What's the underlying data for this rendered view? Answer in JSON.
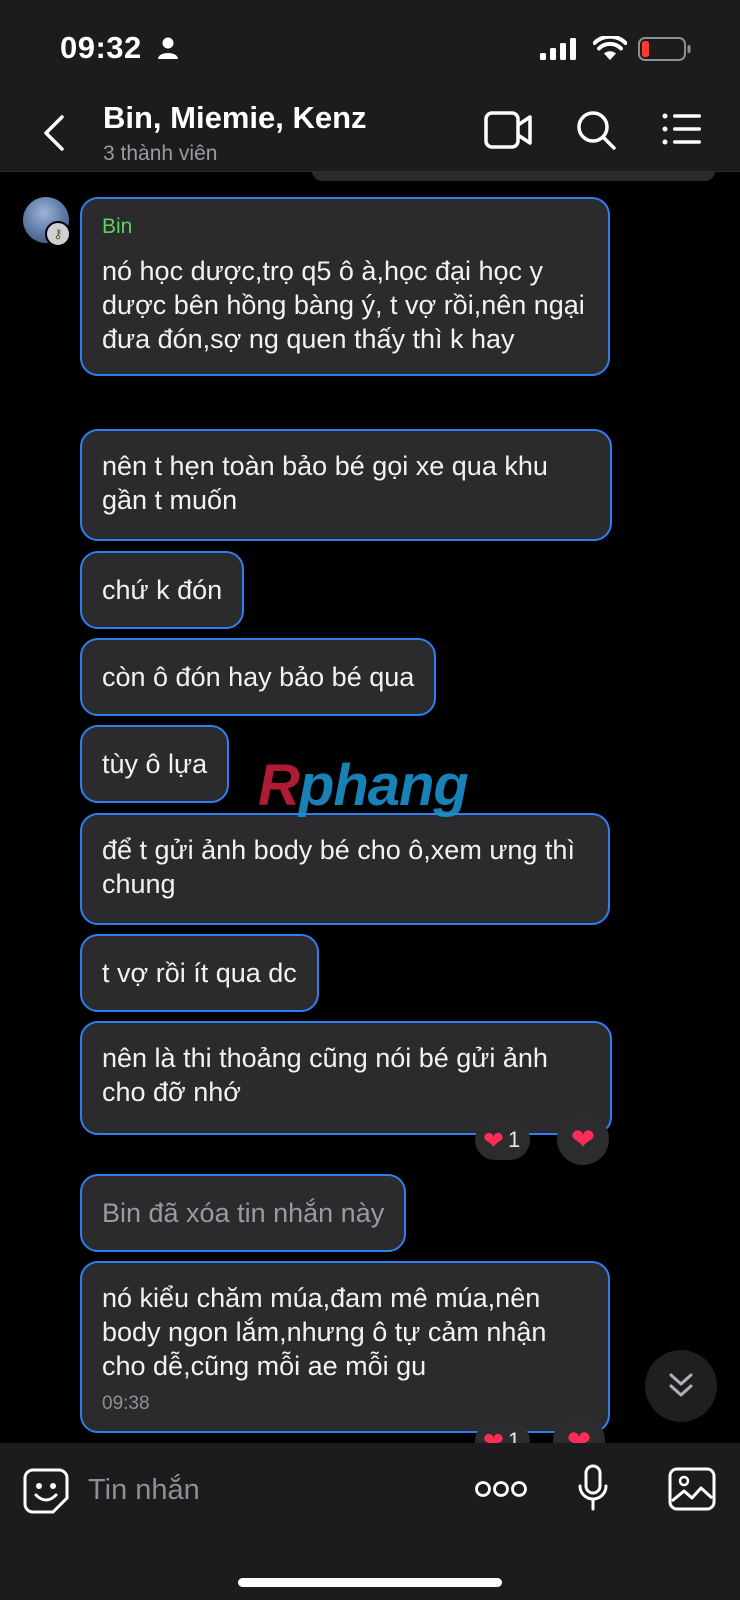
{
  "status_bar": {
    "time": "09:32"
  },
  "header": {
    "title": "Bin, Miemie, Kenz",
    "subtitle": "3 thành viên"
  },
  "messages": [
    {
      "sender": "Bin",
      "text": "nó học dược,trọ q5 ô à,học đại học y dược bên hồng bàng ý, t vợ rồi,nên ngại đưa đón,sợ ng quen thấy thì k hay"
    },
    {
      "text": "nên t hẹn toàn bảo bé gọi xe qua khu gần t muốn"
    },
    {
      "text": "chứ k đón"
    },
    {
      "text": "còn ô đón hay bảo bé qua"
    },
    {
      "text": "tùy ô lựa"
    },
    {
      "text": "để  t gửi ảnh body bé cho ô,xem ưng thì chung"
    },
    {
      "text": "t vợ rồi ít qua dc"
    },
    {
      "text": "nên là thi thoảng cũng nói bé gửi ảnh cho đỡ nhớ",
      "reaction": {
        "emoji": "❤",
        "count": "1"
      }
    },
    {
      "text": "Bin đã xóa tin nhắn này",
      "deleted": true
    },
    {
      "text": "nó kiểu chăm múa,đam mê múa,nên body ngon lắm,nhưng ô tự cảm nhận cho dễ,cũng mỗi ae mỗi gu",
      "time": "09:38",
      "reaction": {
        "emoji": "❤",
        "count": "1"
      }
    }
  ],
  "react_button_emoji": "❤",
  "watermark": {
    "first": "R",
    "rest": "phang"
  },
  "input": {
    "placeholder": "Tin nhắn"
  },
  "icons": {
    "back": "chevron-left-icon",
    "video": "video-camera-icon",
    "search": "search-icon",
    "menu": "list-menu-icon",
    "sticker": "sticker-smile-icon",
    "more": "more-dots-icon",
    "mic": "microphone-icon",
    "image": "image-icon",
    "scroll": "double-chevron-down-icon"
  },
  "colors": {
    "bubble_border": "#2f7ff0",
    "bubble_bg": "#2b2b2d",
    "sender_name": "#5ad25a",
    "heart": "#ff2d55",
    "battery_low": "#ff3b30"
  }
}
